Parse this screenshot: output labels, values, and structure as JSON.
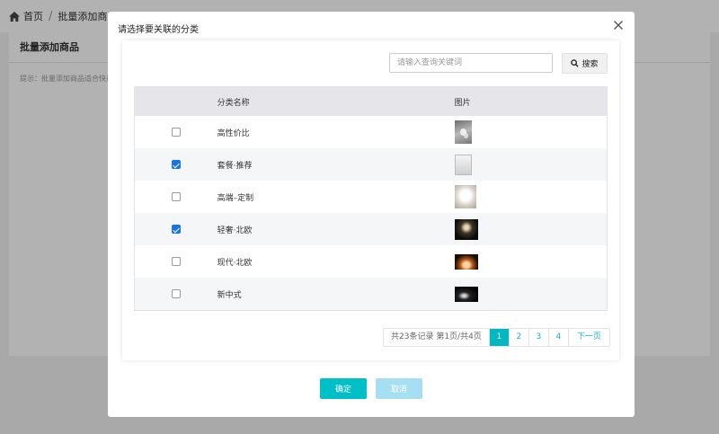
{
  "breadcrumb": {
    "home": "首页",
    "separator": "/",
    "current": "批量添加商品"
  },
  "background_panel": {
    "title": "批量添加商品",
    "tip": "提示：批量添加商品适合快速…"
  },
  "modal": {
    "title": "请选择要关联的分类",
    "search": {
      "placeholder": "请输入查询关键词",
      "value": "",
      "button_label": "搜索"
    },
    "table": {
      "headers": {
        "name": "分类名称",
        "image": "图片"
      },
      "rows": [
        {
          "name": "高性价比",
          "checked": false,
          "image_icon": "thumb-pendant-lamp"
        },
        {
          "name": "套餐·推荐",
          "checked": true,
          "image_icon": "thumb-white-lamp"
        },
        {
          "name": "高端–定制",
          "checked": false,
          "image_icon": "thumb-crystal-chandelier"
        },
        {
          "name": "轻奢·北欧",
          "checked": true,
          "image_icon": "thumb-dark-chandelier"
        },
        {
          "name": "现代·北欧",
          "checked": false,
          "image_icon": "thumb-warm-lamp"
        },
        {
          "name": "新中式",
          "checked": false,
          "image_icon": "thumb-night-lamp"
        }
      ]
    },
    "pagination": {
      "info": "共23条记录 第1页/共4页",
      "pages": [
        "1",
        "2",
        "3",
        "4"
      ],
      "current": "1",
      "next_label": "下一页"
    },
    "buttons": {
      "confirm": "确定",
      "cancel": "取消"
    }
  },
  "colors": {
    "primary": "#00bfc6",
    "cancel": "#a6dff2",
    "checkbox": "#1a73e8",
    "link": "#12b5c2"
  }
}
